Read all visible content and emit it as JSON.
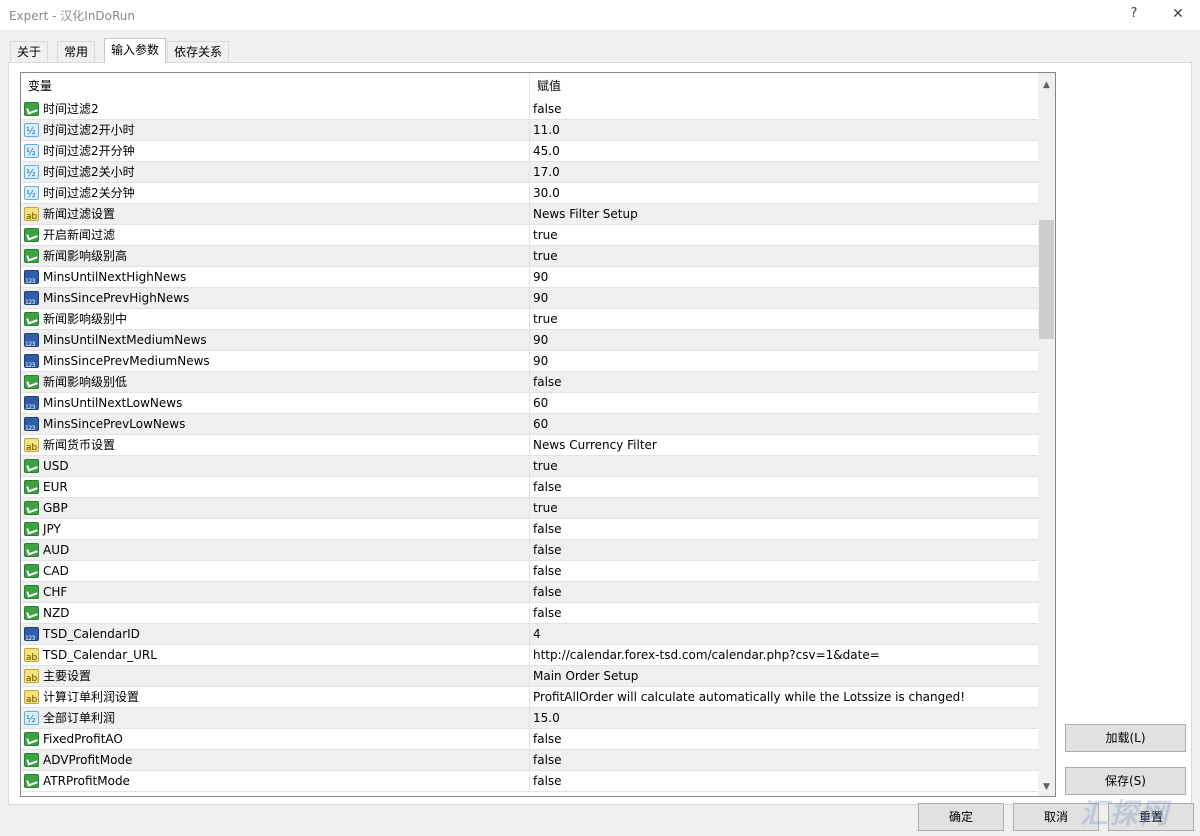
{
  "window": {
    "title": "Expert - 汉化InDoRun",
    "help_label": "?",
    "close_label": "✕"
  },
  "tabs": [
    {
      "label": "关于"
    },
    {
      "label": "常用"
    },
    {
      "label": "输入参数"
    },
    {
      "label": "依存关系"
    }
  ],
  "table": {
    "col_variable": "变量",
    "col_value": "赋值",
    "rows": [
      {
        "icon": "bool",
        "name": "时间过滤2",
        "value": "false"
      },
      {
        "icon": "dbl",
        "name": "时间过滤2开小时",
        "value": "11.0"
      },
      {
        "icon": "dbl",
        "name": "时间过滤2开分钟",
        "value": "45.0"
      },
      {
        "icon": "dbl",
        "name": "时间过滤2关小时",
        "value": "17.0"
      },
      {
        "icon": "dbl",
        "name": "时间过滤2关分钟",
        "value": "30.0"
      },
      {
        "icon": "str",
        "name": "新闻过滤设置",
        "value": "News Filter Setup"
      },
      {
        "icon": "bool",
        "name": "开启新闻过滤",
        "value": "true"
      },
      {
        "icon": "bool",
        "name": "新闻影响级别高",
        "value": "true"
      },
      {
        "icon": "int",
        "name": "MinsUntilNextHighNews",
        "value": "90"
      },
      {
        "icon": "int",
        "name": "MinsSincePrevHighNews",
        "value": "90"
      },
      {
        "icon": "bool",
        "name": "新闻影响级别中",
        "value": "true"
      },
      {
        "icon": "int",
        "name": "MinsUntilNextMediumNews",
        "value": "90"
      },
      {
        "icon": "int",
        "name": "MinsSincePrevMediumNews",
        "value": "90"
      },
      {
        "icon": "bool",
        "name": "新闻影响级别低",
        "value": "false"
      },
      {
        "icon": "int",
        "name": "MinsUntilNextLowNews",
        "value": "60"
      },
      {
        "icon": "int",
        "name": "MinsSincePrevLowNews",
        "value": "60"
      },
      {
        "icon": "str",
        "name": "新闻货币设置",
        "value": "News Currency Filter"
      },
      {
        "icon": "bool",
        "name": "USD",
        "value": "true"
      },
      {
        "icon": "bool",
        "name": "EUR",
        "value": "false"
      },
      {
        "icon": "bool",
        "name": "GBP",
        "value": "true"
      },
      {
        "icon": "bool",
        "name": "JPY",
        "value": "false"
      },
      {
        "icon": "bool",
        "name": "AUD",
        "value": "false"
      },
      {
        "icon": "bool",
        "name": "CAD",
        "value": "false"
      },
      {
        "icon": "bool",
        "name": "CHF",
        "value": "false"
      },
      {
        "icon": "bool",
        "name": "NZD",
        "value": "false"
      },
      {
        "icon": "int",
        "name": "TSD_CalendarID",
        "value": "4"
      },
      {
        "icon": "str",
        "name": "TSD_Calendar_URL",
        "value": "http://calendar.forex-tsd.com/calendar.php?csv=1&date="
      },
      {
        "icon": "str",
        "name": "主要设置",
        "value": "Main Order Setup"
      },
      {
        "icon": "str",
        "name": "计算订单利润设置",
        "value": " ProfitAllOrder will calculate automatically while the Lotssize is changed!"
      },
      {
        "icon": "dbl",
        "name": "全部订单利润",
        "value": "15.0"
      },
      {
        "icon": "bool",
        "name": "FixedProfitAO",
        "value": "false"
      },
      {
        "icon": "bool",
        "name": "ADVProfitMode",
        "value": "false"
      },
      {
        "icon": "bool",
        "name": "ATRProfitMode",
        "value": "false"
      }
    ]
  },
  "buttons": {
    "load": "加载(L)",
    "save": "保存(S)",
    "ok": "确定",
    "cancel": "取消",
    "reset": "重置"
  },
  "watermark": "汇探网"
}
